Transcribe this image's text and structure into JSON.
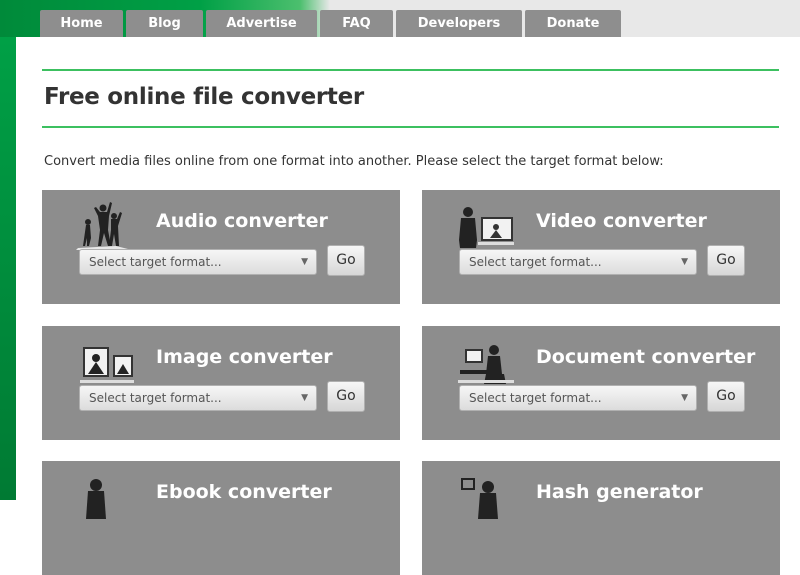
{
  "nav": {
    "tabs": [
      {
        "label": "Home"
      },
      {
        "label": "Blog"
      },
      {
        "label": "Advertise"
      },
      {
        "label": "FAQ"
      },
      {
        "label": "Developers"
      },
      {
        "label": "Donate"
      }
    ]
  },
  "main": {
    "title": "Free online file converter",
    "intro": "Convert media files online from one format into another. Please select the target format below:"
  },
  "converters": [
    {
      "title": "Audio converter",
      "icon": "dancers-icon",
      "select_placeholder": "Select target format...",
      "go_label": "Go"
    },
    {
      "title": "Video converter",
      "icon": "video-viewer-icon",
      "select_placeholder": "Select target format...",
      "go_label": "Go"
    },
    {
      "title": "Image converter",
      "icon": "image-frames-icon",
      "select_placeholder": "Select target format...",
      "go_label": "Go"
    },
    {
      "title": "Document converter",
      "icon": "desk-worker-icon",
      "select_placeholder": "Select target format...",
      "go_label": "Go"
    },
    {
      "title": "Ebook converter",
      "icon": "reader-icon",
      "select_placeholder": "",
      "go_label": ""
    },
    {
      "title": "Hash generator",
      "icon": "hash-person-icon",
      "select_placeholder": "",
      "go_label": ""
    }
  ],
  "colors": {
    "brand_green": "#00a046",
    "rule_green": "#3cc060",
    "nav_tab_bg": "#8e8e8e",
    "card_bg": "#8d8d8d"
  }
}
